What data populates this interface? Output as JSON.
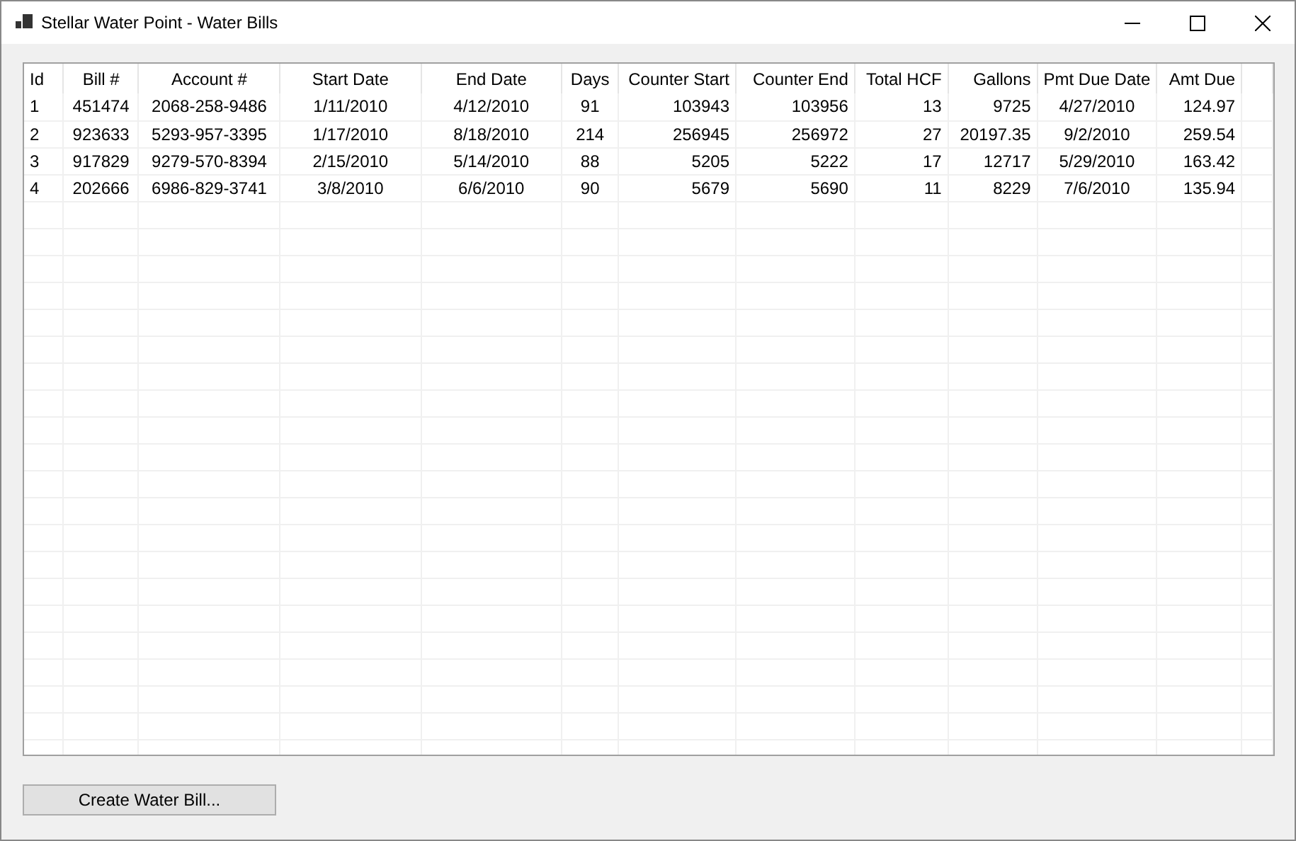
{
  "window": {
    "title": "Stellar Water Point - Water Bills"
  },
  "table": {
    "columns": [
      {
        "label": "Id"
      },
      {
        "label": "Bill #"
      },
      {
        "label": "Account #"
      },
      {
        "label": "Start Date"
      },
      {
        "label": "End Date"
      },
      {
        "label": "Days"
      },
      {
        "label": "Counter Start"
      },
      {
        "label": "Counter End"
      },
      {
        "label": "Total HCF"
      },
      {
        "label": "Gallons"
      },
      {
        "label": "Pmt Due Date"
      },
      {
        "label": "Amt Due"
      }
    ],
    "rows": [
      [
        "1",
        "451474",
        "2068-258-9486",
        "1/11/2010",
        "4/12/2010",
        "91",
        "103943",
        "103956",
        "13",
        "9725",
        "4/27/2010",
        "124.97"
      ],
      [
        "2",
        "923633",
        "5293-957-3395",
        "1/17/2010",
        "8/18/2010",
        "214",
        "256945",
        "256972",
        "27",
        "20197.35",
        "9/2/2010",
        "259.54"
      ],
      [
        "3",
        "917829",
        "9279-570-8394",
        "2/15/2010",
        "5/14/2010",
        "88",
        "5205",
        "5222",
        "17",
        "12717",
        "5/29/2010",
        "163.42"
      ],
      [
        "4",
        "202666",
        "6986-829-3741",
        "3/8/2010",
        "6/6/2010",
        "90",
        "5679",
        "5690",
        "11",
        "8229",
        "7/6/2010",
        "135.94"
      ]
    ]
  },
  "buttons": [
    {
      "label": "Create Water Bill..."
    }
  ]
}
